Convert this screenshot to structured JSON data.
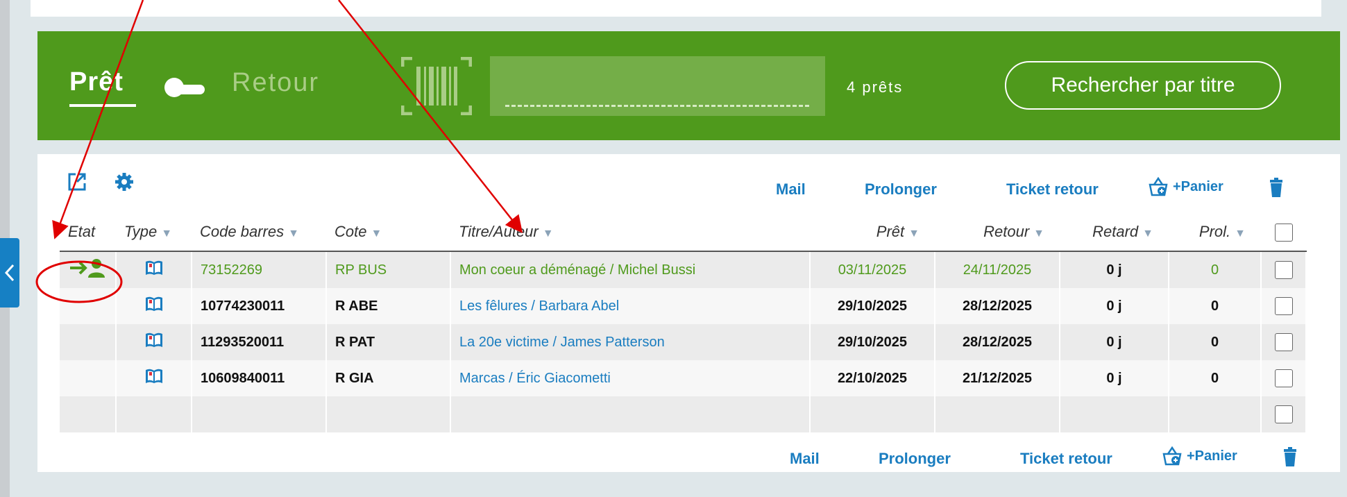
{
  "colors": {
    "brand_green": "#4f9a1c",
    "link_blue": "#1a7dc0",
    "annotation_red": "#e00000"
  },
  "sidebar": {
    "collapse_icon": "chevron-left-icon"
  },
  "header": {
    "tab_pret": "Prêt",
    "tab_retour": "Retour",
    "barcode_icon": "barcode-icon",
    "loan_count": "4 prêts",
    "search_button": "Rechercher par titre"
  },
  "toolbar": {
    "mail": "Mail",
    "prolonger": "Prolonger",
    "ticket_retour": "Ticket retour",
    "panier": "+Panier",
    "icons": [
      "export-icon",
      "gear-icon",
      "basket-add-icon",
      "trash-icon"
    ]
  },
  "table": {
    "columns": [
      "Etat",
      "Type",
      "Code barres",
      "Cote",
      "Titre/Auteur",
      "Prêt",
      "Retour",
      "Retard",
      "Prol."
    ],
    "rows": [
      {
        "etat_icon": "checkout-arrow-person-icon",
        "type_icon": "book-icon",
        "code": "73152269",
        "cote": "RP BUS",
        "titre": "Mon coeur a déménagé / Michel Bussi",
        "pret": "03/11/2025",
        "retour": "24/11/2025",
        "retard": "0 j",
        "prol": "0"
      },
      {
        "etat_icon": "",
        "type_icon": "book-icon",
        "code": "10774230011",
        "cote": "R ABE",
        "titre": "Les fêlures / Barbara Abel",
        "pret": "29/10/2025",
        "retour": "28/12/2025",
        "retard": "0 j",
        "prol": "0"
      },
      {
        "etat_icon": "",
        "type_icon": "book-icon",
        "code": "11293520011",
        "cote": "R PAT",
        "titre": "La 20e victime / James Patterson",
        "pret": "29/10/2025",
        "retour": "28/12/2025",
        "retard": "0 j",
        "prol": "0"
      },
      {
        "etat_icon": "",
        "type_icon": "book-icon",
        "code": "10609840011",
        "cote": "R GIA",
        "titre": "Marcas / Éric Giacometti",
        "pret": "22/10/2025",
        "retour": "21/12/2025",
        "retard": "0 j",
        "prol": "0"
      }
    ]
  }
}
